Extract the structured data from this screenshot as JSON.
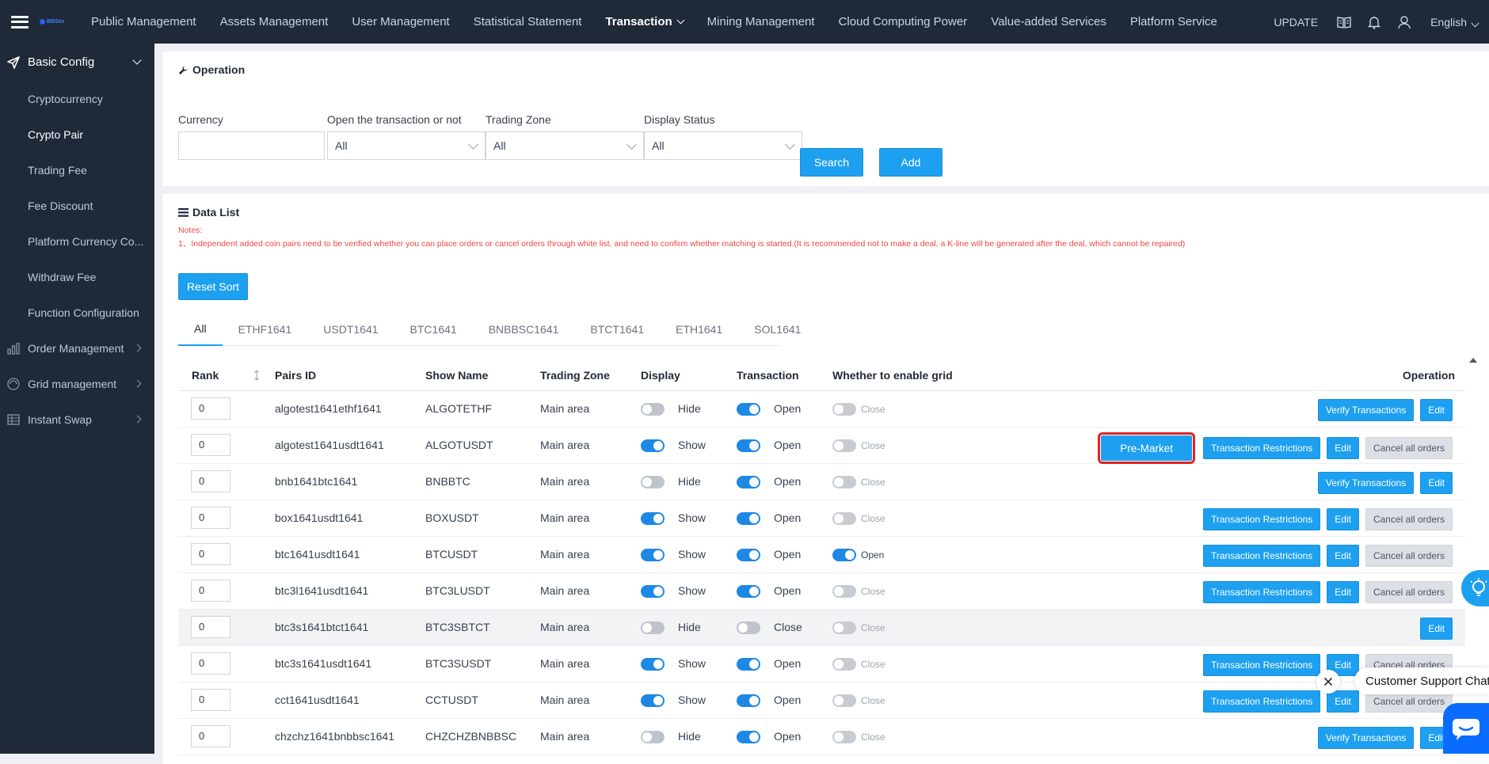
{
  "topbar": {
    "nav": [
      "Public Management",
      "Assets Management",
      "User Management",
      "Statistical Statement",
      "Transaction",
      "Mining Management",
      "Cloud Computing Power",
      "Value-added Services",
      "Platform Service"
    ],
    "active_nav": "Transaction",
    "update": "UPDATE",
    "language": "English"
  },
  "sidebar": {
    "section": "Basic Config",
    "items": [
      "Cryptocurrency",
      "Crypto Pair",
      "Trading Fee",
      "Fee Discount",
      "Platform Currency Co...",
      "Withdraw Fee",
      "Function Configuration"
    ],
    "active_item": "Crypto Pair",
    "groups": [
      "Order Management",
      "Grid management",
      "Instant Swap"
    ]
  },
  "operation": {
    "title": "Operation",
    "currency_label": "Currency",
    "currency_value": "",
    "open_label": "Open the transaction or not",
    "open_value": "All",
    "zone_label": "Trading Zone",
    "zone_value": "All",
    "display_label": "Display Status",
    "display_value": "All",
    "search": "Search",
    "add": "Add"
  },
  "datalist": {
    "title": "Data List",
    "notes_title": "Notes:",
    "note1": "1、Independent added coin pairs need to be verified whether you can place orders or cancel orders through white list, and need to confirm whether matching is started.(It is recommended not to make a deal, a K-line will be generated after the deal, which cannot be repaired)",
    "reset_sort": "Reset Sort",
    "tabs": [
      "All",
      "ETHF1641",
      "USDT1641",
      "BTC1641",
      "BNBBSC1641",
      "BTCT1641",
      "ETH1641",
      "SOL1641"
    ],
    "columns": {
      "rank": "Rank",
      "pair": "Pairs ID",
      "show": "Show Name",
      "zone": "Trading Zone",
      "display": "Display",
      "transaction": "Transaction",
      "grid": "Whether to enable grid",
      "operation": "Operation"
    },
    "rows": [
      {
        "rank": "0",
        "pair": "algotest1641ethf1641",
        "show": "ALGOTETHF",
        "zone": "Main area",
        "display": "Hide",
        "display_on": false,
        "tx": "Open",
        "tx_on": true,
        "grid": "Close",
        "grid_on": false,
        "ops": [
          "Verify Transactions",
          "Edit"
        ]
      },
      {
        "rank": "0",
        "pair": "algotest1641usdt1641",
        "show": "ALGOTUSDT",
        "zone": "Main area",
        "display": "Show",
        "display_on": true,
        "tx": "Open",
        "tx_on": true,
        "grid": "Close",
        "grid_on": false,
        "ops": [
          "Pre-Market",
          "Transaction Restrictions",
          "Edit",
          "Cancel all orders"
        ]
      },
      {
        "rank": "0",
        "pair": "bnb1641btc1641",
        "show": "BNBBTC",
        "zone": "Main area",
        "display": "Hide",
        "display_on": false,
        "tx": "Open",
        "tx_on": true,
        "grid": "Close",
        "grid_on": false,
        "ops": [
          "Verify Transactions",
          "Edit"
        ]
      },
      {
        "rank": "0",
        "pair": "box1641usdt1641",
        "show": "BOXUSDT",
        "zone": "Main area",
        "display": "Show",
        "display_on": true,
        "tx": "Open",
        "tx_on": true,
        "grid": "Close",
        "grid_on": false,
        "ops": [
          "Transaction Restrictions",
          "Edit",
          "Cancel all orders"
        ]
      },
      {
        "rank": "0",
        "pair": "btc1641usdt1641",
        "show": "BTCUSDT",
        "zone": "Main area",
        "display": "Show",
        "display_on": true,
        "tx": "Open",
        "tx_on": true,
        "grid": "Open",
        "grid_on": true,
        "ops": [
          "Transaction Restrictions",
          "Edit",
          "Cancel all orders"
        ]
      },
      {
        "rank": "0",
        "pair": "btc3l1641usdt1641",
        "show": "BTC3LUSDT",
        "zone": "Main area",
        "display": "Show",
        "display_on": true,
        "tx": "Open",
        "tx_on": true,
        "grid": "Close",
        "grid_on": false,
        "ops": [
          "Transaction Restrictions",
          "Edit",
          "Cancel all orders"
        ]
      },
      {
        "rank": "0",
        "pair": "btc3s1641btct1641",
        "show": "BTC3SBTCT",
        "zone": "Main area",
        "display": "Hide",
        "display_on": false,
        "tx": "Close",
        "tx_on": false,
        "grid": "Close",
        "grid_on": false,
        "ops": [
          "Edit"
        ]
      },
      {
        "rank": "0",
        "pair": "btc3s1641usdt1641",
        "show": "BTC3SUSDT",
        "zone": "Main area",
        "display": "Show",
        "display_on": true,
        "tx": "Open",
        "tx_on": true,
        "grid": "Close",
        "grid_on": false,
        "ops": [
          "Transaction Restrictions",
          "Edit",
          "Cancel all orders"
        ]
      },
      {
        "rank": "0",
        "pair": "cct1641usdt1641",
        "show": "CCTUSDT",
        "zone": "Main area",
        "display": "Show",
        "display_on": true,
        "tx": "Open",
        "tx_on": true,
        "grid": "Close",
        "grid_on": false,
        "ops": [
          "Transaction Restrictions",
          "Edit",
          "Cancel all orders"
        ]
      },
      {
        "rank": "0",
        "pair": "chzchz1641bnbbsc1641",
        "show": "CHZCHZBNBBSC",
        "zone": "Main area",
        "display": "Hide",
        "display_on": false,
        "tx": "Open",
        "tx_on": true,
        "grid": "Close",
        "grid_on": false,
        "ops": [
          "Verify Transactions",
          "Edit"
        ]
      }
    ]
  },
  "support": {
    "chat": "Customer Support Chat"
  },
  "colors": {
    "topbar": "#1f2937",
    "primary": "#1ea0f0",
    "highlight": "#e02424"
  }
}
